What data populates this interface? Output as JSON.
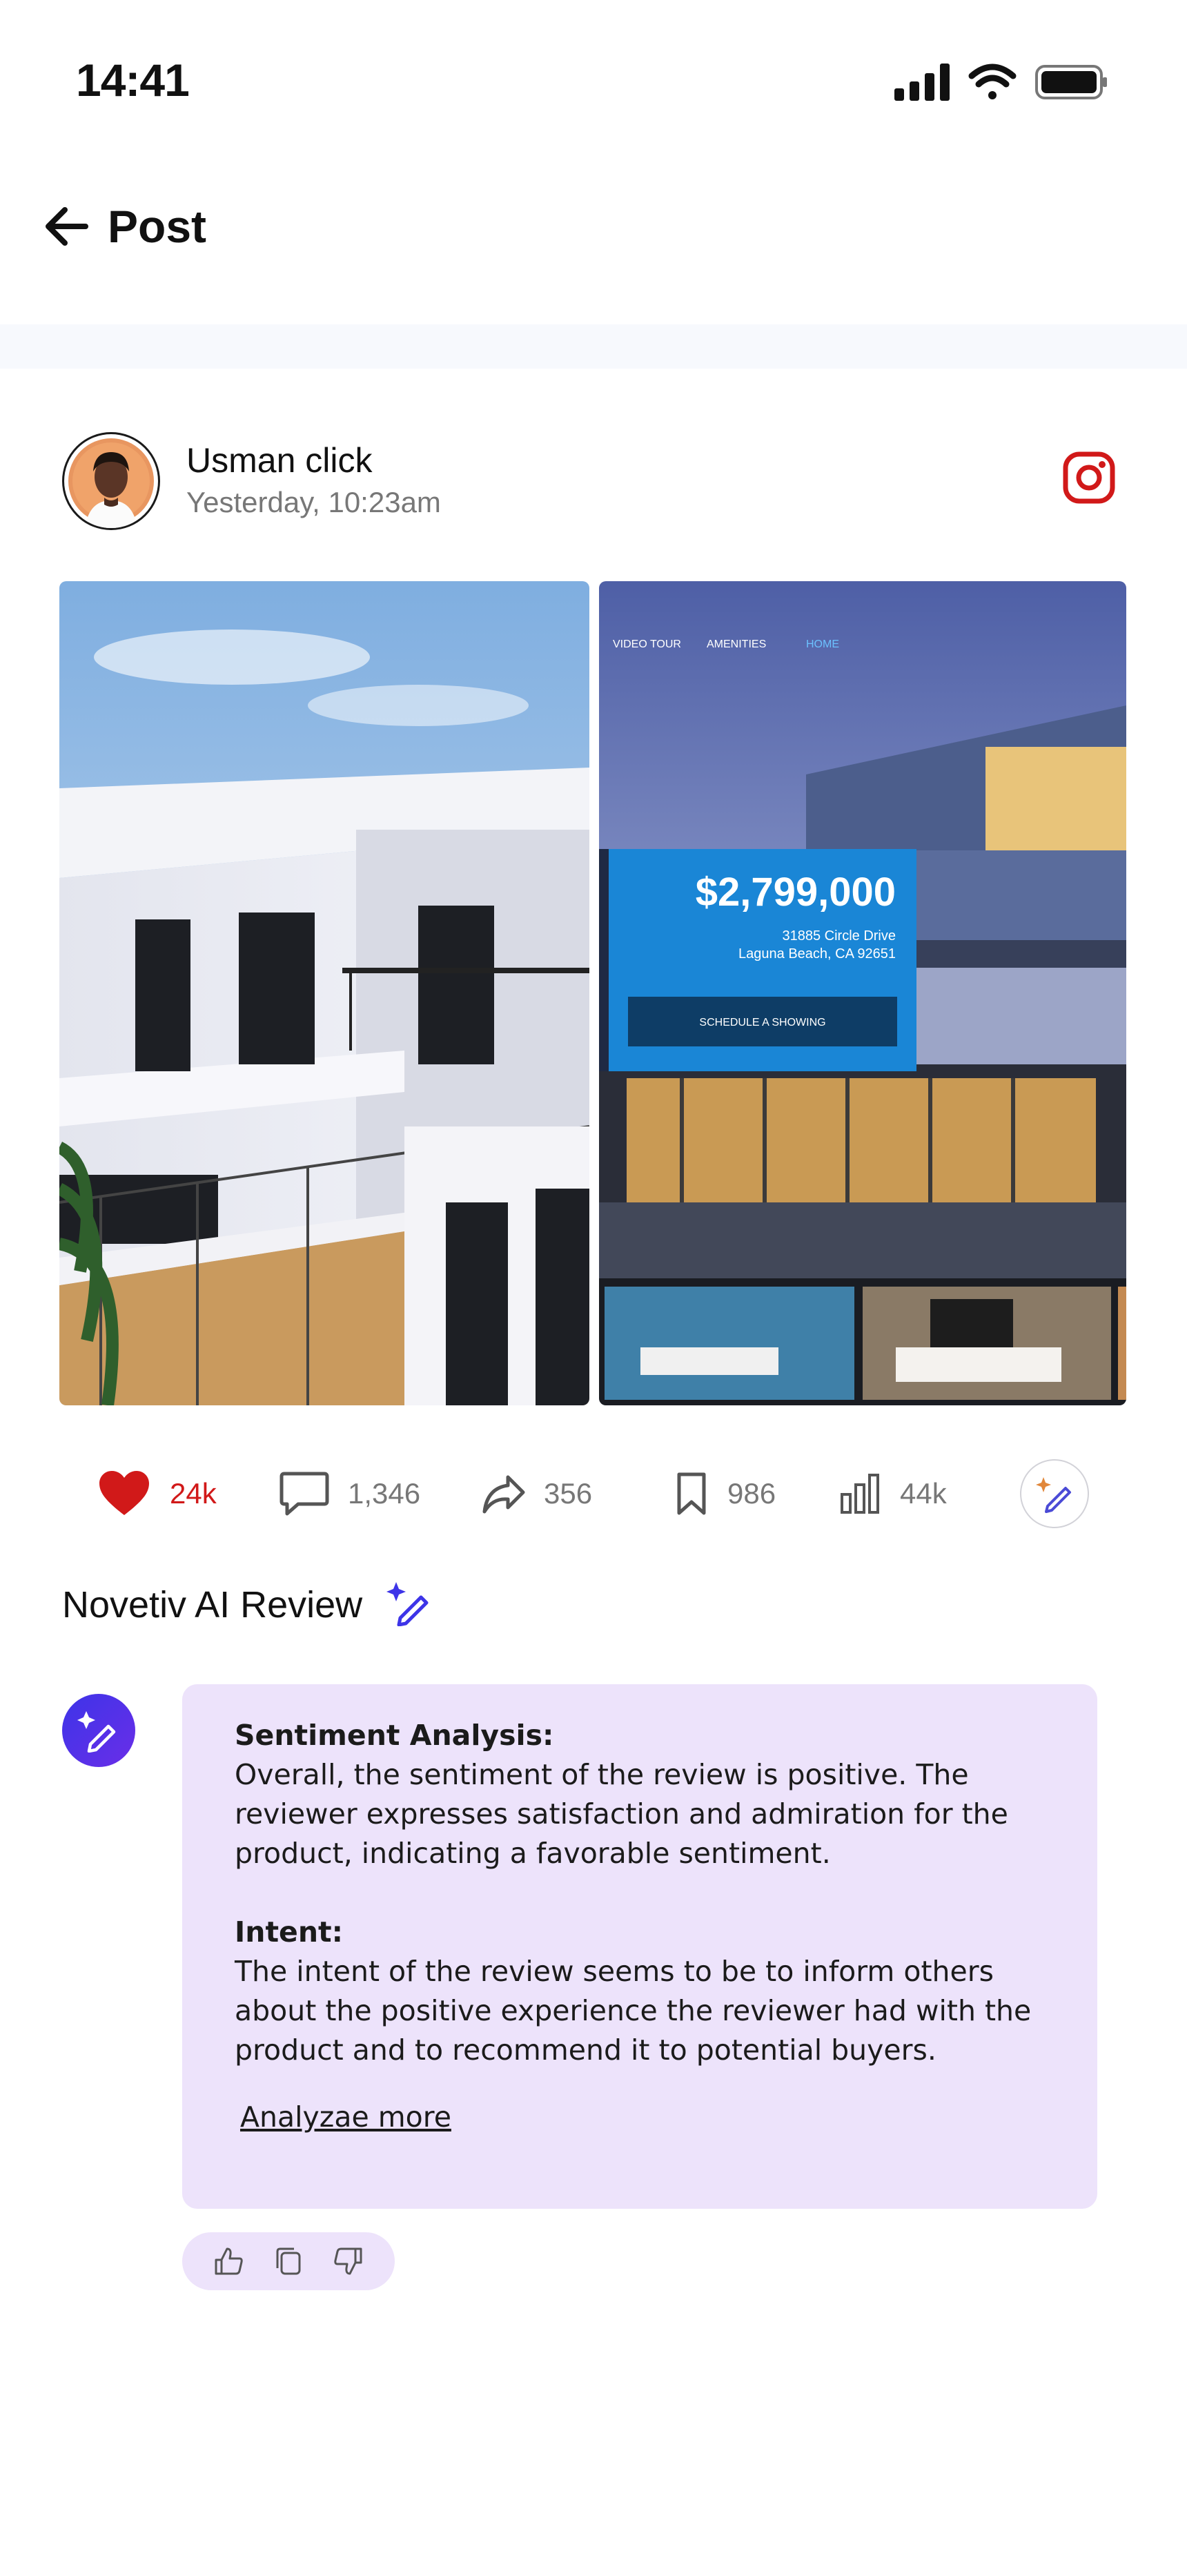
{
  "status_bar": {
    "time": "14:41"
  },
  "header": {
    "title": "Post"
  },
  "post": {
    "author": "Usman click",
    "time": "Yesterday, 10:23am",
    "listing": {
      "nav": [
        "VIDEO TOUR",
        "AMENITIES",
        "HOME"
      ],
      "price": "$2,799,000",
      "address_line1": "31885 Circle Drive",
      "address_line2": "Laguna Beach, CA 92651",
      "cta": "SCHEDULE A SHOWING"
    }
  },
  "stats": {
    "likes": "24k",
    "comments": "1,346",
    "shares": "356",
    "saves": "986",
    "views": "44k"
  },
  "ai_review": {
    "title": "Novetiv AI Review",
    "sentiment_heading": "Sentiment Analysis:",
    "sentiment_text": "Overall, the sentiment of the review is positive. The reviewer expresses satisfaction and admiration for the product, indicating a favorable sentiment.",
    "intent_heading": "Intent:",
    "intent_text": "The intent of the review seems to be to inform others about the positive experience the reviewer had with the product and to recommend it to potential buyers.",
    "more_link": "Analyzae more"
  },
  "colors": {
    "like": "#d11919",
    "accent": "#3d34e8",
    "card_bg": "#ede3fb"
  }
}
